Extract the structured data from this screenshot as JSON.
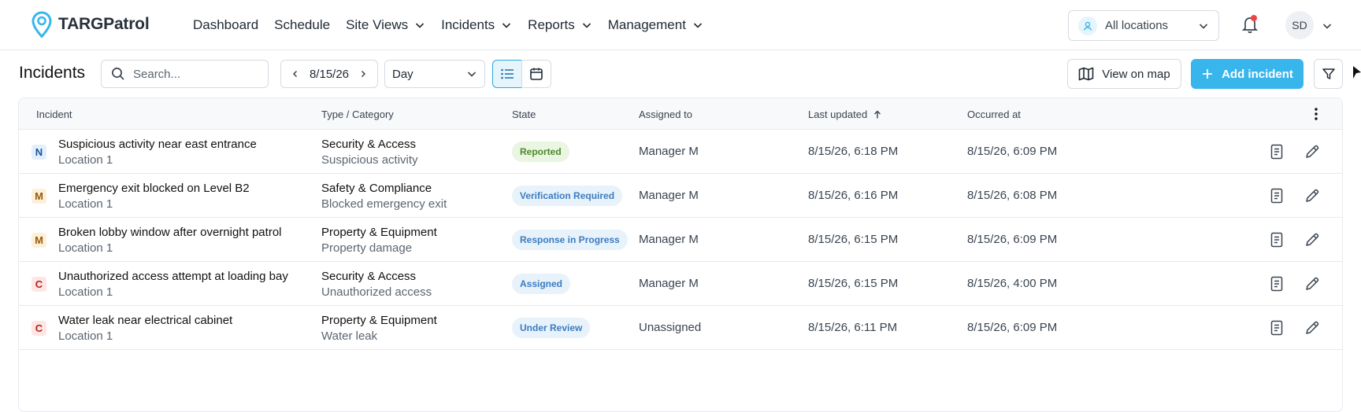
{
  "app": {
    "name": "TARGPatrol",
    "brand_color": "#38b6ec"
  },
  "nav": {
    "items": [
      {
        "label": "Dashboard",
        "has_menu": false
      },
      {
        "label": "Schedule",
        "has_menu": false
      },
      {
        "label": "Site Views",
        "has_menu": true
      },
      {
        "label": "Incidents",
        "has_menu": true
      },
      {
        "label": "Reports",
        "has_menu": true
      },
      {
        "label": "Management",
        "has_menu": true
      }
    ]
  },
  "header": {
    "location_selector": "All locations",
    "user_initials": "SD",
    "notification_icon": "bell-icon"
  },
  "toolbar": {
    "page_title": "Incidents",
    "search_placeholder": "Search...",
    "date": "8/15/26",
    "range": "Day",
    "view_on_map": "View on map",
    "add_incident": "Add incident"
  },
  "table": {
    "columns": {
      "incident": "Incident",
      "type": "Type / Category",
      "state": "State",
      "assigned": "Assigned to",
      "updated": "Last updated",
      "occurred": "Occurred at"
    },
    "rows": [
      {
        "priority": "N",
        "priority_color": "#1e4fa3",
        "priority_bg": "#e3f0fb",
        "title": "Suspicious activity near east entrance",
        "location": "Location 1",
        "type": "Security & Access",
        "category": "Suspicious activity",
        "state": "Reported",
        "state_color": "#4d8a2a",
        "state_bg": "#eaf5e2",
        "assigned": "Manager M",
        "updated": "8/15/26, 6:18 PM",
        "occurred": "8/15/26, 6:09 PM"
      },
      {
        "priority": "M",
        "priority_color": "#9a5a08",
        "priority_bg": "#fdf0d9",
        "title": "Emergency exit blocked on Level B2",
        "location": "Location 1",
        "type": "Safety & Compliance",
        "category": "Blocked emergency exit",
        "state": "Verification Required",
        "state_color": "#3a7cc0",
        "state_bg": "#e8f2fb",
        "assigned": "Manager M",
        "updated": "8/15/26, 6:16 PM",
        "occurred": "8/15/26, 6:08 PM"
      },
      {
        "priority": "M",
        "priority_color": "#9a5a08",
        "priority_bg": "#fdf0d9",
        "title": "Broken lobby window after overnight patrol",
        "location": "Location 1",
        "type": "Property & Equipment",
        "category": "Property damage",
        "state": "Response in Progress",
        "state_color": "#3a7cc0",
        "state_bg": "#e8f2fb",
        "assigned": "Manager M",
        "updated": "8/15/26, 6:15 PM",
        "occurred": "8/15/26, 6:09 PM"
      },
      {
        "priority": "C",
        "priority_color": "#b4231b",
        "priority_bg": "#fde6e4",
        "title": "Unauthorized access attempt at loading bay",
        "location": "Location 1",
        "type": "Security & Access",
        "category": "Unauthorized access",
        "state": "Assigned",
        "state_color": "#3a7cc0",
        "state_bg": "#e8f2fb",
        "assigned": "Manager M",
        "updated": "8/15/26, 6:15 PM",
        "occurred": "8/15/26, 4:00 PM"
      },
      {
        "priority": "C",
        "priority_color": "#b4231b",
        "priority_bg": "#fde6e4",
        "title": "Water leak near electrical cabinet",
        "location": "Location 1",
        "type": "Property & Equipment",
        "category": "Water leak",
        "state": "Under Review",
        "state_color": "#3a7cc0",
        "state_bg": "#e8f2fb",
        "assigned": "Unassigned",
        "updated": "8/15/26, 6:11 PM",
        "occurred": "8/15/26, 6:09 PM"
      }
    ]
  }
}
